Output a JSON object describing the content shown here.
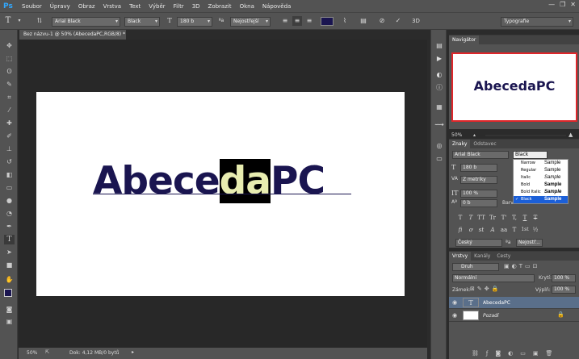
{
  "app": {
    "logo": "Ps"
  },
  "menu": [
    "Soubor",
    "Úpravy",
    "Obraz",
    "Vrstva",
    "Text",
    "Výběr",
    "Filtr",
    "3D",
    "Zobrazit",
    "Okna",
    "Nápověda"
  ],
  "window_controls": [
    "—",
    "❐",
    "✕"
  ],
  "options": {
    "font_family": "Arial Black",
    "font_style": "Black",
    "font_size": "180 b",
    "antialias": "Nejostřejší",
    "color": "#1a1550",
    "workspace": "Typografie"
  },
  "document": {
    "tab_title": "Bez názvu-1 @ 50% (AbecedaPC,RGB/8) *",
    "text_before": "Abece",
    "text_selected": "da",
    "text_after": "PC",
    "text_color": "#1a1550",
    "status_zoom": "50%",
    "status_info": "Dok: 4,12 MB/0 bytů"
  },
  "navigator": {
    "tabs": [
      "Navigátor"
    ],
    "preview_text": "AbecedaPC",
    "zoom": "50%"
  },
  "character": {
    "tabs": [
      "Znaky",
      "Odstavec"
    ],
    "font_family": "Arial Black",
    "font_style": "Black",
    "font_size": "180 b",
    "kerning": "Z metriky",
    "vertical_scale": "100 %",
    "baseline": "0 b",
    "color_label": "Barva:",
    "language": "Český",
    "antialias": "Nejostř...",
    "style_buttons": [
      "T",
      "T",
      "TT",
      "Tr",
      "T'",
      "T,",
      "T",
      "T"
    ],
    "opentype_buttons": [
      "fi",
      "ơ",
      "st",
      "A",
      "aa",
      "T",
      "1st",
      "½"
    ]
  },
  "font_styles": [
    {
      "name": "Narrow",
      "sample": "Sample",
      "selected": false
    },
    {
      "name": "Regular",
      "sample": "Sample",
      "selected": false
    },
    {
      "name": "Italic",
      "sample": "Sample",
      "selected": false
    },
    {
      "name": "Bold",
      "sample": "Sample",
      "selected": false
    },
    {
      "name": "Bold Italic",
      "sample": "Sample",
      "selected": false
    },
    {
      "name": "Black",
      "sample": "Sample",
      "selected": true
    }
  ],
  "layers_panel": {
    "tabs": [
      "Vrstvy",
      "Kanály",
      "Cesty"
    ],
    "filter": "Druh",
    "blend_mode": "Normální",
    "opacity_label": "Krytí:",
    "opacity": "100 %",
    "lock_label": "Zámek:",
    "fill_label": "Výplň:",
    "fill": "100 %",
    "layers": [
      {
        "name": "AbecedaPC",
        "type": "text",
        "selected": true
      },
      {
        "name": "Pozadí",
        "type": "background",
        "selected": false
      }
    ]
  }
}
